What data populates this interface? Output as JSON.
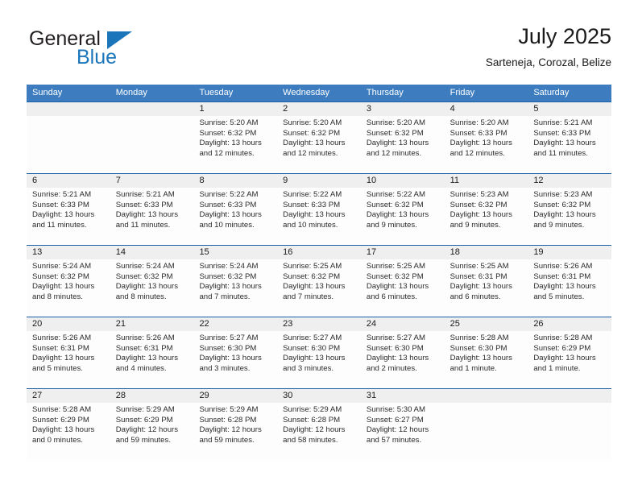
{
  "brand": {
    "word1": "General",
    "word2": "Blue",
    "accent_color": "#1b75bb"
  },
  "header": {
    "title": "July 2025",
    "subtitle": "Sarteneja, Corozal, Belize"
  },
  "calendar": {
    "header_bg": "#3d7dbf",
    "weekday_headers": [
      "Sunday",
      "Monday",
      "Tuesday",
      "Wednesday",
      "Thursday",
      "Friday",
      "Saturday"
    ],
    "weeks": [
      [
        {
          "day": "",
          "sunrise": "",
          "sunset": "",
          "daylight": ""
        },
        {
          "day": "",
          "sunrise": "",
          "sunset": "",
          "daylight": ""
        },
        {
          "day": "1",
          "sunrise": "Sunrise: 5:20 AM",
          "sunset": "Sunset: 6:32 PM",
          "daylight": "Daylight: 13 hours and 12 minutes."
        },
        {
          "day": "2",
          "sunrise": "Sunrise: 5:20 AM",
          "sunset": "Sunset: 6:32 PM",
          "daylight": "Daylight: 13 hours and 12 minutes."
        },
        {
          "day": "3",
          "sunrise": "Sunrise: 5:20 AM",
          "sunset": "Sunset: 6:32 PM",
          "daylight": "Daylight: 13 hours and 12 minutes."
        },
        {
          "day": "4",
          "sunrise": "Sunrise: 5:20 AM",
          "sunset": "Sunset: 6:33 PM",
          "daylight": "Daylight: 13 hours and 12 minutes."
        },
        {
          "day": "5",
          "sunrise": "Sunrise: 5:21 AM",
          "sunset": "Sunset: 6:33 PM",
          "daylight": "Daylight: 13 hours and 11 minutes."
        }
      ],
      [
        {
          "day": "6",
          "sunrise": "Sunrise: 5:21 AM",
          "sunset": "Sunset: 6:33 PM",
          "daylight": "Daylight: 13 hours and 11 minutes."
        },
        {
          "day": "7",
          "sunrise": "Sunrise: 5:21 AM",
          "sunset": "Sunset: 6:33 PM",
          "daylight": "Daylight: 13 hours and 11 minutes."
        },
        {
          "day": "8",
          "sunrise": "Sunrise: 5:22 AM",
          "sunset": "Sunset: 6:33 PM",
          "daylight": "Daylight: 13 hours and 10 minutes."
        },
        {
          "day": "9",
          "sunrise": "Sunrise: 5:22 AM",
          "sunset": "Sunset: 6:33 PM",
          "daylight": "Daylight: 13 hours and 10 minutes."
        },
        {
          "day": "10",
          "sunrise": "Sunrise: 5:22 AM",
          "sunset": "Sunset: 6:32 PM",
          "daylight": "Daylight: 13 hours and 9 minutes."
        },
        {
          "day": "11",
          "sunrise": "Sunrise: 5:23 AM",
          "sunset": "Sunset: 6:32 PM",
          "daylight": "Daylight: 13 hours and 9 minutes."
        },
        {
          "day": "12",
          "sunrise": "Sunrise: 5:23 AM",
          "sunset": "Sunset: 6:32 PM",
          "daylight": "Daylight: 13 hours and 9 minutes."
        }
      ],
      [
        {
          "day": "13",
          "sunrise": "Sunrise: 5:24 AM",
          "sunset": "Sunset: 6:32 PM",
          "daylight": "Daylight: 13 hours and 8 minutes."
        },
        {
          "day": "14",
          "sunrise": "Sunrise: 5:24 AM",
          "sunset": "Sunset: 6:32 PM",
          "daylight": "Daylight: 13 hours and 8 minutes."
        },
        {
          "day": "15",
          "sunrise": "Sunrise: 5:24 AM",
          "sunset": "Sunset: 6:32 PM",
          "daylight": "Daylight: 13 hours and 7 minutes."
        },
        {
          "day": "16",
          "sunrise": "Sunrise: 5:25 AM",
          "sunset": "Sunset: 6:32 PM",
          "daylight": "Daylight: 13 hours and 7 minutes."
        },
        {
          "day": "17",
          "sunrise": "Sunrise: 5:25 AM",
          "sunset": "Sunset: 6:32 PM",
          "daylight": "Daylight: 13 hours and 6 minutes."
        },
        {
          "day": "18",
          "sunrise": "Sunrise: 5:25 AM",
          "sunset": "Sunset: 6:31 PM",
          "daylight": "Daylight: 13 hours and 6 minutes."
        },
        {
          "day": "19",
          "sunrise": "Sunrise: 5:26 AM",
          "sunset": "Sunset: 6:31 PM",
          "daylight": "Daylight: 13 hours and 5 minutes."
        }
      ],
      [
        {
          "day": "20",
          "sunrise": "Sunrise: 5:26 AM",
          "sunset": "Sunset: 6:31 PM",
          "daylight": "Daylight: 13 hours and 5 minutes."
        },
        {
          "day": "21",
          "sunrise": "Sunrise: 5:26 AM",
          "sunset": "Sunset: 6:31 PM",
          "daylight": "Daylight: 13 hours and 4 minutes."
        },
        {
          "day": "22",
          "sunrise": "Sunrise: 5:27 AM",
          "sunset": "Sunset: 6:30 PM",
          "daylight": "Daylight: 13 hours and 3 minutes."
        },
        {
          "day": "23",
          "sunrise": "Sunrise: 5:27 AM",
          "sunset": "Sunset: 6:30 PM",
          "daylight": "Daylight: 13 hours and 3 minutes."
        },
        {
          "day": "24",
          "sunrise": "Sunrise: 5:27 AM",
          "sunset": "Sunset: 6:30 PM",
          "daylight": "Daylight: 13 hours and 2 minutes."
        },
        {
          "day": "25",
          "sunrise": "Sunrise: 5:28 AM",
          "sunset": "Sunset: 6:30 PM",
          "daylight": "Daylight: 13 hours and 1 minute."
        },
        {
          "day": "26",
          "sunrise": "Sunrise: 5:28 AM",
          "sunset": "Sunset: 6:29 PM",
          "daylight": "Daylight: 13 hours and 1 minute."
        }
      ],
      [
        {
          "day": "27",
          "sunrise": "Sunrise: 5:28 AM",
          "sunset": "Sunset: 6:29 PM",
          "daylight": "Daylight: 13 hours and 0 minutes."
        },
        {
          "day": "28",
          "sunrise": "Sunrise: 5:29 AM",
          "sunset": "Sunset: 6:29 PM",
          "daylight": "Daylight: 12 hours and 59 minutes."
        },
        {
          "day": "29",
          "sunrise": "Sunrise: 5:29 AM",
          "sunset": "Sunset: 6:28 PM",
          "daylight": "Daylight: 12 hours and 59 minutes."
        },
        {
          "day": "30",
          "sunrise": "Sunrise: 5:29 AM",
          "sunset": "Sunset: 6:28 PM",
          "daylight": "Daylight: 12 hours and 58 minutes."
        },
        {
          "day": "31",
          "sunrise": "Sunrise: 5:30 AM",
          "sunset": "Sunset: 6:27 PM",
          "daylight": "Daylight: 12 hours and 57 minutes."
        },
        {
          "day": "",
          "sunrise": "",
          "sunset": "",
          "daylight": ""
        },
        {
          "day": "",
          "sunrise": "",
          "sunset": "",
          "daylight": ""
        }
      ]
    ]
  }
}
